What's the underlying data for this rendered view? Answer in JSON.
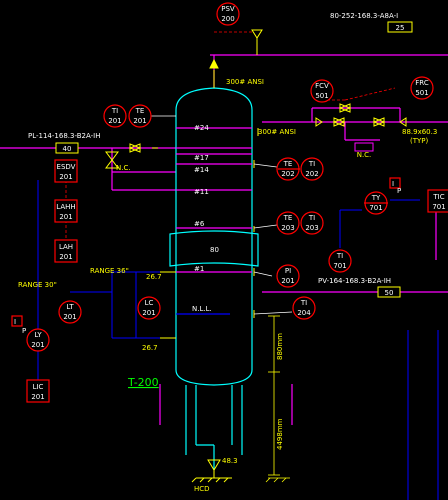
{
  "title": "T-200",
  "instruments": {
    "psv": {
      "code": "PSV",
      "num": "200"
    },
    "ti201": {
      "code": "TI",
      "num": "201"
    },
    "te201": {
      "code": "TE",
      "num": "201"
    },
    "fcv501": {
      "code": "FCV",
      "num": "501"
    },
    "frc501": {
      "code": "FRC",
      "num": "501"
    },
    "esdv201": {
      "code": "ESDV",
      "num": "201"
    },
    "lahh201": {
      "code": "LAHH",
      "num": "201"
    },
    "lah201": {
      "code": "LAH",
      "num": "201"
    },
    "lt201": {
      "code": "LT",
      "num": "201"
    },
    "lc201": {
      "code": "LC",
      "num": "201"
    },
    "ly201": {
      "code": "LY",
      "num": "201"
    },
    "lic201": {
      "code": "LIC",
      "num": "201"
    },
    "te202": {
      "code": "TE",
      "num": "202"
    },
    "ti202": {
      "code": "TI",
      "num": "202"
    },
    "te203": {
      "code": "TE",
      "num": "203"
    },
    "ti203": {
      "code": "TI",
      "num": "203"
    },
    "pi201": {
      "code": "PI",
      "num": "201"
    },
    "ti204": {
      "code": "TI",
      "num": "204"
    },
    "ty701": {
      "code": "TY",
      "num": "701"
    },
    "tic701": {
      "code": "TIC",
      "num": "701"
    },
    "ti701": {
      "code": "TI",
      "num": "701"
    }
  },
  "lines": {
    "top_line": "80-252-168.3-A8A-I",
    "top_line_num": "25",
    "pl_line": "PL-114-168.3-B2A-IH",
    "pl_line_num": "40",
    "pv_line": "PV-164-168.3-B2A-IH",
    "pv_line_num": "50"
  },
  "trays": [
    "#24",
    "#17",
    "#14",
    "#11",
    "#6",
    "#1"
  ],
  "labels": {
    "ansi_top": "300# ANSI",
    "ansi_side": "300# ANSI",
    "nc_left": "N.C.",
    "nc_right": "N.C.",
    "reducer": "88.9x60.3",
    "reducer_typ": "(TYP)",
    "range_left": "RANGE 30\"",
    "range_mid": "RANGE 36\"",
    "dim_267_top": "26.7",
    "dim_267_bot": "26.7",
    "packing": "80",
    "nll": "N.L.L.",
    "dim_880": "880mm",
    "dim_4498": "4498mm",
    "drain_size": "48.3",
    "hcd": "HCD",
    "i_left": "I",
    "p_left": "P",
    "i_right": "I",
    "p_right": "P"
  },
  "colors": {
    "magenta": "#ff00ff",
    "cyan": "#00ffff",
    "red": "#ff0000",
    "yellow": "#ffff00",
    "blue": "#0000ff",
    "green": "#00ff00",
    "white": "#ffffff"
  }
}
